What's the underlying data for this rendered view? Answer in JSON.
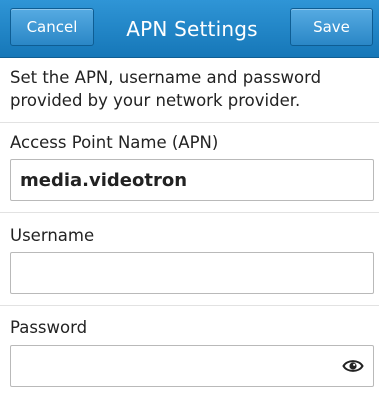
{
  "header": {
    "title": "APN Settings",
    "cancel_label": "Cancel",
    "save_label": "Save"
  },
  "intro_text": "Set the APN, username and password provided by your network provider.",
  "fields": {
    "apn": {
      "label": "Access Point Name (APN)",
      "value": "media.videotron"
    },
    "username": {
      "label": "Username",
      "value": ""
    },
    "password": {
      "label": "Password",
      "value": "",
      "toggle_icon": "eye-icon"
    }
  },
  "colors": {
    "titlebar": "#1f86c9",
    "button": "#3a97d4",
    "text": "#222222",
    "border": "#b9b9b9"
  }
}
